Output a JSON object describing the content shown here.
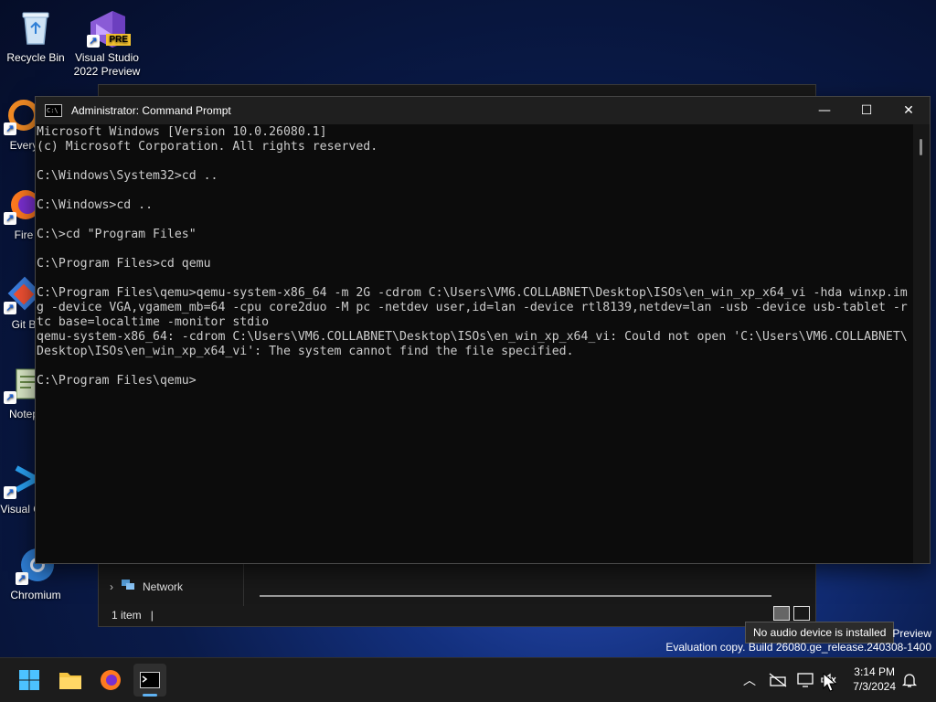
{
  "desktop": {
    "icons": [
      {
        "label": "Recycle Bin"
      },
      {
        "label": "Visual Studio 2022 Preview",
        "badge": "PRE"
      },
      {
        "label": "Every"
      },
      {
        "label": "Fire"
      },
      {
        "label": "Git B"
      },
      {
        "label": "Notep"
      },
      {
        "label": "Visual Co"
      },
      {
        "label": "Chromium"
      }
    ]
  },
  "explorer": {
    "nav_item": "Network",
    "status_text": "1 item"
  },
  "cmd": {
    "title": "Administrator: Command Prompt",
    "icon_text": "C:\\",
    "controls": {
      "minimize": "—",
      "maximize": "☐",
      "close": "✕"
    },
    "lines": [
      "Microsoft Windows [Version 10.0.26080.1]",
      "(c) Microsoft Corporation. All rights reserved.",
      "",
      "C:\\Windows\\System32>cd ..",
      "",
      "C:\\Windows>cd ..",
      "",
      "C:\\>cd \"Program Files\"",
      "",
      "C:\\Program Files>cd qemu",
      "",
      "C:\\Program Files\\qemu>qemu-system-x86_64 -m 2G -cdrom C:\\Users\\VM6.COLLABNET\\Desktop\\ISOs\\en_win_xp_x64_vi -hda winxp.im",
      "g -device VGA,vgamem_mb=64 -cpu core2duo -M pc -netdev user,id=lan -device rtl8139,netdev=lan -usb -device usb-tablet -r",
      "tc base=localtime -monitor stdio",
      "qemu-system-x86_64: -cdrom C:\\Users\\VM6.COLLABNET\\Desktop\\ISOs\\en_win_xp_x64_vi: Could not open 'C:\\Users\\VM6.COLLABNET\\",
      "Desktop\\ISOs\\en_win_xp_x64_vi': The system cannot find the file specified.",
      "",
      "C:\\Program Files\\qemu>"
    ]
  },
  "tooltip": "No audio device is installed",
  "watermark": {
    "line1": "Preview",
    "line2": "Evaluation copy. Build 26080.ge_release.240308-1400"
  },
  "taskbar": {
    "clock_time": "3:14 PM",
    "clock_date": "7/3/2024",
    "accent": "#5fb2f2"
  }
}
